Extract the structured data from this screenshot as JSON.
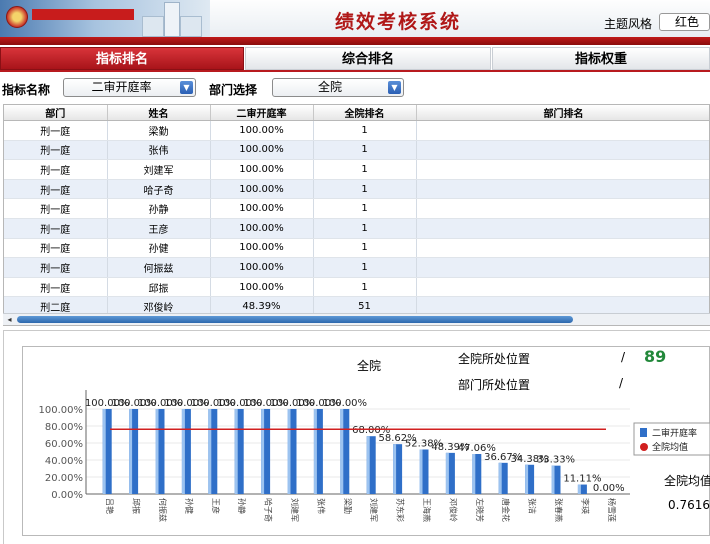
{
  "header": {
    "app_title": "绩效考核系统",
    "theme_label": "主题风格",
    "theme_value": "红色"
  },
  "tabs": [
    {
      "label": "指标排名",
      "active": true
    },
    {
      "label": "综合排名",
      "active": false
    },
    {
      "label": "指标权重",
      "active": false
    }
  ],
  "filters": {
    "indicator_label": "指标名称",
    "indicator_value": "二审开庭率",
    "dept_label": "部门选择",
    "dept_value": "全院"
  },
  "table": {
    "columns": [
      "部门",
      "姓名",
      "二审开庭率",
      "全院排名",
      "部门排名"
    ],
    "rows": [
      [
        "刑一庭",
        "梁勤",
        "100.00%",
        "1",
        ""
      ],
      [
        "刑一庭",
        "张伟",
        "100.00%",
        "1",
        ""
      ],
      [
        "刑一庭",
        "刘建军",
        "100.00%",
        "1",
        ""
      ],
      [
        "刑一庭",
        "哈子奇",
        "100.00%",
        "1",
        ""
      ],
      [
        "刑一庭",
        "孙静",
        "100.00%",
        "1",
        ""
      ],
      [
        "刑一庭",
        "王彦",
        "100.00%",
        "1",
        ""
      ],
      [
        "刑一庭",
        "孙健",
        "100.00%",
        "1",
        ""
      ],
      [
        "刑一庭",
        "何振兹",
        "100.00%",
        "1",
        ""
      ],
      [
        "刑一庭",
        "邱振",
        "100.00%",
        "1",
        ""
      ],
      [
        "刑二庭",
        "邓俊岭",
        "48.39%",
        "51",
        ""
      ]
    ]
  },
  "stats": {
    "chart_heading": "全院",
    "court_position_label": "全院所处位置",
    "court_position_sep": "/",
    "court_position_value": "89",
    "dept_position_label": "部门所处位置",
    "dept_position_sep": "/",
    "avg_label": "全院均值",
    "avg_value": "0.7616"
  },
  "colors": {
    "accent_red": "#b81a1f",
    "bar_blue": "#2f6fc8",
    "avg_line": "#d11f1f",
    "rank_green": "#22883a"
  },
  "chart_data": {
    "type": "bar",
    "categories": [
      "吕艳",
      "邱振",
      "何振兹",
      "孙健",
      "王彦",
      "孙静",
      "哈子奇",
      "刘建军",
      "张伟",
      "梁勤",
      "刘建军",
      "苏东彩",
      "王海燕",
      "邓俊岭",
      "左晓芳",
      "唐金花",
      "张洁",
      "张春燕",
      "李瑛",
      "杨雪莲"
    ],
    "series": [
      {
        "name": "二审开庭率",
        "values": [
          100,
          100,
          100,
          100,
          100,
          100,
          100,
          100,
          100,
          100,
          68.0,
          58.62,
          52.38,
          48.39,
          47.06,
          36.67,
          34.38,
          33.33,
          11.11,
          0
        ]
      },
      {
        "name": "全院均值",
        "values": [
          76.16
        ]
      }
    ],
    "value_labels": [
      "100.00%",
      "100.00%",
      "100.00%",
      "100.00%",
      "100.00%",
      "100.00%",
      "100.00%",
      "100.00%",
      "100.00%",
      "100.00%",
      "68.00%",
      "58.62%",
      "52.38%",
      "48.39%",
      "47.06%",
      "36.67%",
      "34.38%",
      "33.33%",
      "11.11%",
      "0.00%"
    ],
    "y_ticks": [
      "100.00%",
      "80.00%",
      "60.00%",
      "40.00%",
      "20.00%",
      "0.00%"
    ],
    "ylim": [
      0,
      120
    ],
    "legend_position": "right"
  }
}
